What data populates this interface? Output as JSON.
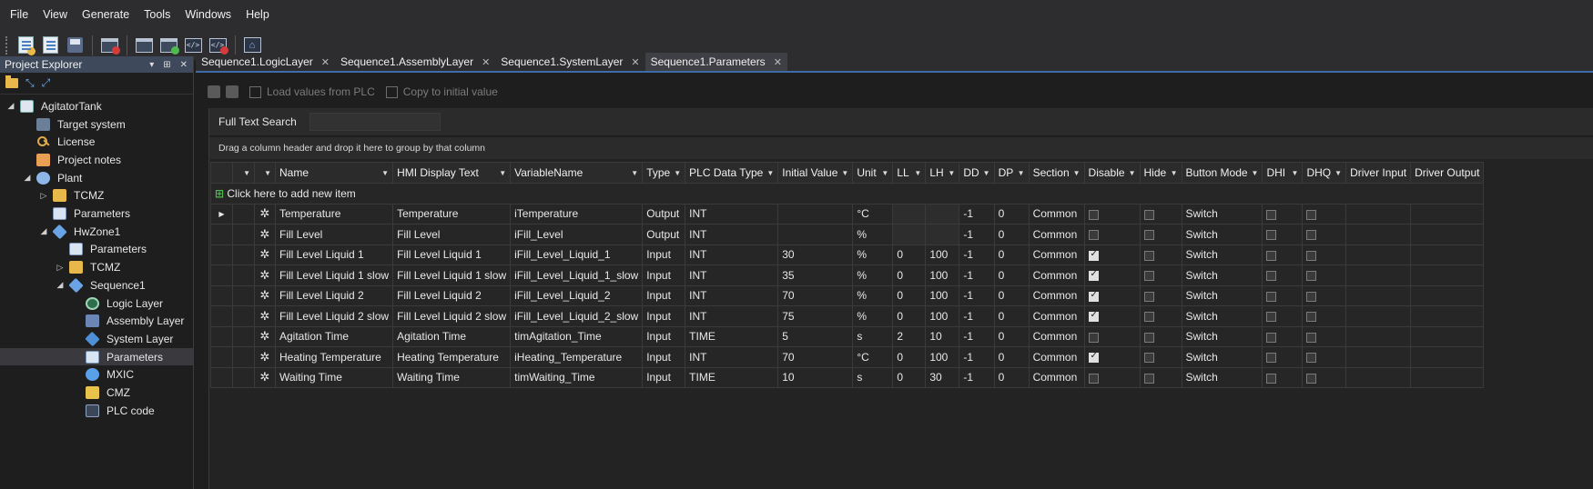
{
  "menu": [
    "File",
    "View",
    "Generate",
    "Tools",
    "Windows",
    "Help"
  ],
  "explorer": {
    "title": "Project Explorer",
    "controls": [
      "▾",
      "⊞",
      "✕"
    ],
    "tree": [
      {
        "label": "AgitatorTank",
        "icon": "project-icon",
        "depth": 0,
        "arrow": "◢"
      },
      {
        "label": "Target system",
        "icon": "target-system-icon",
        "depth": 1,
        "arrow": ""
      },
      {
        "label": "License",
        "icon": "license-key-icon",
        "depth": 1,
        "arrow": ""
      },
      {
        "label": "Project notes",
        "icon": "notes-icon",
        "depth": 1,
        "arrow": ""
      },
      {
        "label": "Plant",
        "icon": "plant-icon",
        "depth": 1,
        "arrow": "◢"
      },
      {
        "label": "TCMZ",
        "icon": "folder-icon",
        "depth": 2,
        "arrow": "▷"
      },
      {
        "label": "Parameters",
        "icon": "parameters-icon",
        "depth": 2,
        "arrow": ""
      },
      {
        "label": "HwZone1",
        "icon": "hwzone-icon",
        "depth": 2,
        "arrow": "◢"
      },
      {
        "label": "Parameters",
        "icon": "parameters-icon",
        "depth": 3,
        "arrow": ""
      },
      {
        "label": "TCMZ",
        "icon": "folder-icon",
        "depth": 3,
        "arrow": "▷"
      },
      {
        "label": "Sequence1",
        "icon": "sequence-icon",
        "depth": 3,
        "arrow": "◢"
      },
      {
        "label": "Logic Layer",
        "icon": "logic-layer-icon",
        "depth": 4,
        "arrow": ""
      },
      {
        "label": "Assembly Layer",
        "icon": "assembly-layer-icon",
        "depth": 4,
        "arrow": ""
      },
      {
        "label": "System Layer",
        "icon": "system-layer-icon",
        "depth": 4,
        "arrow": ""
      },
      {
        "label": "Parameters",
        "icon": "parameters-icon",
        "depth": 4,
        "arrow": "",
        "selected": true
      },
      {
        "label": "MXIC",
        "icon": "mxic-icon",
        "depth": 4,
        "arrow": ""
      },
      {
        "label": "CMZ",
        "icon": "cmz-icon",
        "depth": 4,
        "arrow": ""
      },
      {
        "label": "PLC code",
        "icon": "plc-code-icon",
        "depth": 4,
        "arrow": ""
      }
    ]
  },
  "tabs": [
    {
      "label": "Sequence1.LogicLayer",
      "active": false
    },
    {
      "label": "Sequence1.AssemblyLayer",
      "active": false
    },
    {
      "label": "Sequence1.SystemLayer",
      "active": false
    },
    {
      "label": "Sequence1.Parameters",
      "active": true
    }
  ],
  "content_toolbar": {
    "load_label": "Load values from PLC",
    "copy_label": "Copy to initial value"
  },
  "search": {
    "label": "Full Text Search",
    "value": ""
  },
  "group_hint": "Drag a column header and drop it here to group by that column",
  "add_row_label": "Click here to add new item",
  "columns": [
    "Name",
    "HMI Display Text",
    "VariableName",
    "Type",
    "PLC Data Type",
    "Initial Value",
    "Unit",
    "LL",
    "LH",
    "DD",
    "DP",
    "Section",
    "Disable",
    "Hide",
    "Button Mode",
    "DHI",
    "DHQ",
    "Driver Input",
    "Driver Output"
  ],
  "rows": [
    {
      "name": "Temperature",
      "hmi": "Temperature",
      "var": "iTemperature",
      "type": "Output",
      "plc": "INT",
      "init": "",
      "unit": "°C",
      "ll": "",
      "lh": "",
      "dd": "-1",
      "dp": "0",
      "section": "Common",
      "disable": false,
      "hide": false,
      "mode": "Switch",
      "current": true
    },
    {
      "name": "Fill Level",
      "hmi": "Fill Level",
      "var": "iFill_Level",
      "type": "Output",
      "plc": "INT",
      "init": "",
      "unit": "%",
      "ll": "",
      "lh": "",
      "dd": "-1",
      "dp": "0",
      "section": "Common",
      "disable": false,
      "hide": false,
      "mode": "Switch"
    },
    {
      "name": "Fill Level Liquid 1",
      "hmi": "Fill Level Liquid 1",
      "var": "iFill_Level_Liquid_1",
      "type": "Input",
      "plc": "INT",
      "init": "30",
      "unit": "%",
      "ll": "0",
      "lh": "100",
      "dd": "-1",
      "dp": "0",
      "section": "Common",
      "disable": true,
      "hide": false,
      "mode": "Switch"
    },
    {
      "name": "Fill Level Liquid 1 slow",
      "hmi": "Fill Level Liquid 1 slow",
      "var": "iFill_Level_Liquid_1_slow",
      "type": "Input",
      "plc": "INT",
      "init": "35",
      "unit": "%",
      "ll": "0",
      "lh": "100",
      "dd": "-1",
      "dp": "0",
      "section": "Common",
      "disable": true,
      "hide": false,
      "mode": "Switch"
    },
    {
      "name": "Fill Level Liquid 2",
      "hmi": "Fill Level Liquid 2",
      "var": "iFill_Level_Liquid_2",
      "type": "Input",
      "plc": "INT",
      "init": "70",
      "unit": "%",
      "ll": "0",
      "lh": "100",
      "dd": "-1",
      "dp": "0",
      "section": "Common",
      "disable": true,
      "hide": false,
      "mode": "Switch"
    },
    {
      "name": "Fill Level Liquid 2 slow",
      "hmi": "Fill Level Liquid 2 slow",
      "var": "iFill_Level_Liquid_2_slow",
      "type": "Input",
      "plc": "INT",
      "init": "75",
      "unit": "%",
      "ll": "0",
      "lh": "100",
      "dd": "-1",
      "dp": "0",
      "section": "Common",
      "disable": true,
      "hide": false,
      "mode": "Switch"
    },
    {
      "name": "Agitation Time",
      "hmi": "Agitation Time",
      "var": "timAgitation_Time",
      "type": "Input",
      "plc": "TIME",
      "init": "5",
      "unit": "s",
      "ll": "2",
      "lh": "10",
      "dd": "-1",
      "dp": "0",
      "section": "Common",
      "disable": false,
      "hide": false,
      "mode": "Switch"
    },
    {
      "name": "Heating Temperature",
      "hmi": "Heating Temperature",
      "var": "iHeating_Temperature",
      "type": "Input",
      "plc": "INT",
      "init": "70",
      "unit": "°C",
      "ll": "0",
      "lh": "100",
      "dd": "-1",
      "dp": "0",
      "section": "Common",
      "disable": true,
      "hide": false,
      "mode": "Switch"
    },
    {
      "name": "Waiting Time",
      "hmi": "Waiting Time",
      "var": "timWaiting_Time",
      "type": "Input",
      "plc": "TIME",
      "init": "10",
      "unit": "s",
      "ll": "0",
      "lh": "30",
      "dd": "-1",
      "dp": "0",
      "section": "Common",
      "disable": false,
      "hide": false,
      "mode": "Switch"
    }
  ]
}
